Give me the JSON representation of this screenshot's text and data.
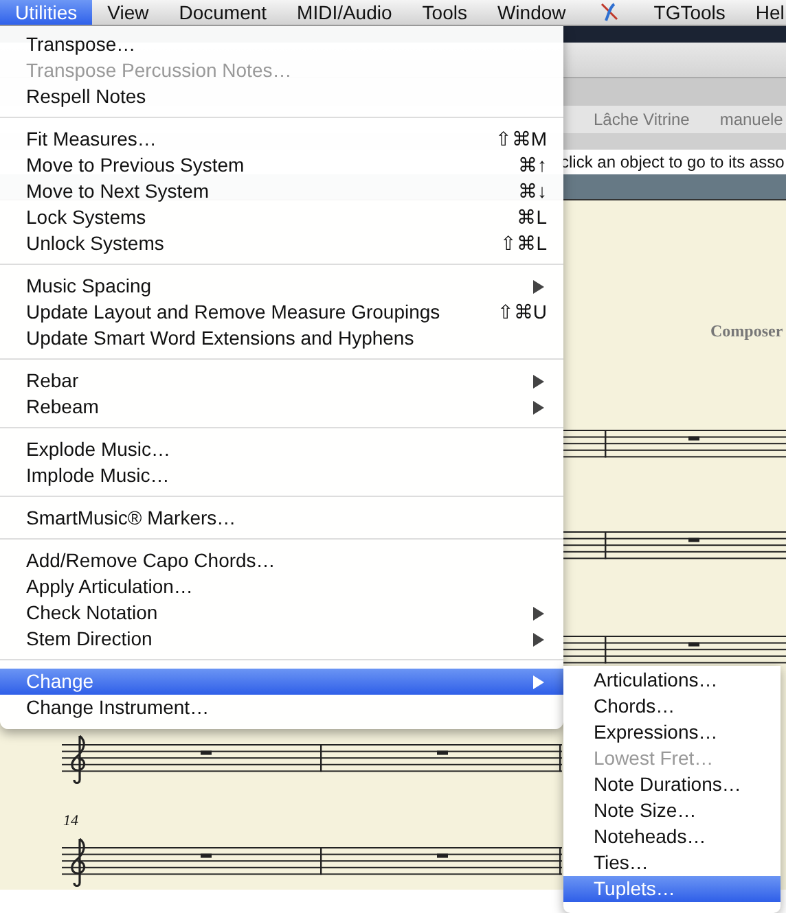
{
  "menu_bar": [
    {
      "label": "Utilities",
      "selected": true
    },
    {
      "label": "View",
      "selected": false
    },
    {
      "label": "Document",
      "selected": false
    },
    {
      "label": "MIDI/Audio",
      "selected": false
    },
    {
      "label": "Tools",
      "selected": false
    },
    {
      "label": "Window",
      "selected": false
    },
    {
      "kind": "icon",
      "selected": false
    },
    {
      "label": "TGTools",
      "selected": false
    },
    {
      "label": "Hel",
      "selected": false
    }
  ],
  "background": {
    "bookmarks": [
      "Lâche Vitrine",
      "manuele"
    ],
    "hint": "click an object to go to its asso",
    "composer": "Composer",
    "measure_number": "14"
  },
  "menu": [
    [
      {
        "label": "Transpose…",
        "disabled": false,
        "selected": false
      },
      {
        "label": "Transpose Percussion Notes…",
        "disabled": true,
        "selected": false
      },
      {
        "label": "Respell Notes",
        "disabled": false,
        "selected": false
      }
    ],
    [
      {
        "label": "Fit Measures…",
        "shortcut": "⇧⌘M",
        "disabled": false,
        "selected": false
      },
      {
        "label": "Move to Previous System",
        "shortcut": "⌘↑",
        "disabled": false,
        "selected": false
      },
      {
        "label": "Move to Next System",
        "shortcut": "⌘↓",
        "disabled": false,
        "selected": false
      },
      {
        "label": "Lock Systems",
        "shortcut": "⌘L",
        "disabled": false,
        "selected": false
      },
      {
        "label": "Unlock Systems",
        "shortcut": "⇧⌘L",
        "disabled": false,
        "selected": false
      }
    ],
    [
      {
        "label": "Music Spacing",
        "submenu": true,
        "disabled": false,
        "selected": false
      },
      {
        "label": "Update Layout and Remove Measure Groupings",
        "shortcut": "⇧⌘U",
        "disabled": false,
        "selected": false
      },
      {
        "label": "Update Smart Word Extensions and Hyphens",
        "disabled": false,
        "selected": false
      }
    ],
    [
      {
        "label": "Rebar",
        "submenu": true,
        "disabled": false,
        "selected": false
      },
      {
        "label": "Rebeam",
        "submenu": true,
        "disabled": false,
        "selected": false
      }
    ],
    [
      {
        "label": "Explode Music…",
        "disabled": false,
        "selected": false
      },
      {
        "label": "Implode Music…",
        "disabled": false,
        "selected": false
      }
    ],
    [
      {
        "label": "SmartMusic® Markers…",
        "disabled": false,
        "selected": false
      }
    ],
    [
      {
        "label": "Add/Remove Capo Chords…",
        "disabled": false,
        "selected": false
      },
      {
        "label": "Apply Articulation…",
        "disabled": false,
        "selected": false
      },
      {
        "label": "Check Notation",
        "submenu": true,
        "disabled": false,
        "selected": false
      },
      {
        "label": "Stem Direction",
        "submenu": true,
        "disabled": false,
        "selected": false
      }
    ],
    [
      {
        "label": "Change",
        "submenu": true,
        "disabled": false,
        "selected": true
      },
      {
        "label": "Change Instrument…",
        "disabled": false,
        "selected": false
      }
    ]
  ],
  "submenu": [
    {
      "label": "Articulations…",
      "disabled": false,
      "selected": false
    },
    {
      "label": "Chords…",
      "disabled": false,
      "selected": false
    },
    {
      "label": "Expressions…",
      "disabled": false,
      "selected": false
    },
    {
      "label": "Lowest Fret…",
      "disabled": true,
      "selected": false
    },
    {
      "label": "Note Durations…",
      "disabled": false,
      "selected": false
    },
    {
      "label": "Note Size…",
      "disabled": false,
      "selected": false
    },
    {
      "label": "Noteheads…",
      "disabled": false,
      "selected": false
    },
    {
      "label": "Ties…",
      "disabled": false,
      "selected": false
    },
    {
      "label": "Tuplets…",
      "disabled": false,
      "selected": true
    }
  ]
}
